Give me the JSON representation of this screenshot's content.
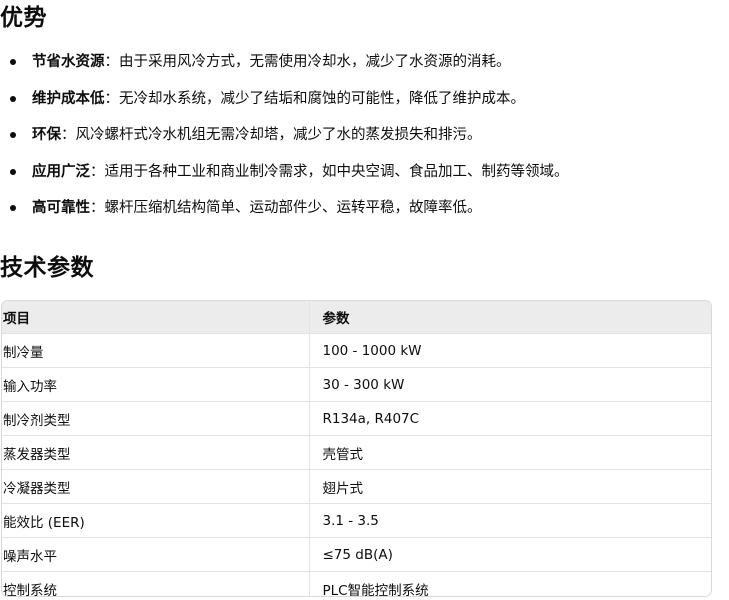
{
  "advantages": {
    "heading": "优势",
    "items": [
      {
        "term": "节省水资源",
        "desc": "：由于采用风冷方式，无需使用冷却水，减少了水资源的消耗。"
      },
      {
        "term": "维护成本低",
        "desc": "：无冷却水系统，减少了结垢和腐蚀的可能性，降低了维护成本。"
      },
      {
        "term": "环保",
        "desc": "：风冷螺杆式冷水机组无需冷却塔，减少了水的蒸发损失和排污。"
      },
      {
        "term": "应用广泛",
        "desc": "：适用于各种工业和商业制冷需求，如中央空调、食品加工、制药等领域。"
      },
      {
        "term": "高可靠性",
        "desc": "：螺杆压缩机结构简单、运动部件少、运转平稳，故障率低。"
      }
    ]
  },
  "specs": {
    "heading": "技术参数",
    "columns": [
      "项目",
      "参数"
    ],
    "rows": [
      [
        "制冷量",
        "100 - 1000 kW"
      ],
      [
        "输入功率",
        "30 - 300 kW"
      ],
      [
        "制冷剂类型",
        "R134a, R407C"
      ],
      [
        "蒸发器类型",
        "壳管式"
      ],
      [
        "冷凝器类型",
        "翅片式"
      ],
      [
        "能效比 (EER)",
        "3.1 - 3.5"
      ],
      [
        "噪声水平",
        "≤75 dB(A)"
      ],
      [
        "控制系统",
        "PLC智能控制系统"
      ]
    ]
  }
}
